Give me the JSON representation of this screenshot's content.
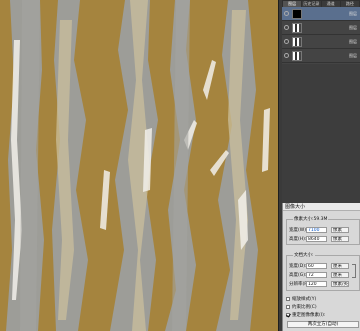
{
  "layers_panel": {
    "tabs": [
      "图层",
      "历史记录",
      "通道",
      "路径"
    ],
    "active_tab": 0,
    "layers": [
      {
        "name": "",
        "selected": true,
        "thumb": "black",
        "right_label": "图层"
      },
      {
        "name": "",
        "selected": false,
        "thumb": "pattern",
        "right_label": "图层"
      },
      {
        "name": "",
        "selected": false,
        "thumb": "pattern",
        "right_label": "图层"
      },
      {
        "name": "",
        "selected": false,
        "thumb": "pattern",
        "right_label": "图层"
      }
    ]
  },
  "image_size_dialog": {
    "title": "图像大小",
    "pixel_dims_label": "像素大小:59.3M",
    "width_label": "宽度(W):",
    "width_value": "7100",
    "height_label": "高度(H):",
    "height_value": "8640",
    "pixel_unit": "像素",
    "doc_size_label": "文档大小:",
    "doc_width_label": "宽度(D):",
    "doc_width_value": "60",
    "doc_height_label": "高度(G):",
    "doc_height_value": "72",
    "doc_unit": "厘米",
    "resolution_label": "分辨率(R):",
    "resolution_value": "120",
    "resolution_unit": "像素/英寸",
    "checkboxes": [
      {
        "label": "缩放样式(Y)",
        "checked": false
      },
      {
        "label": "约束比例(C)",
        "checked": false
      },
      {
        "label": "重定图像像素(I):",
        "checked": true
      }
    ],
    "resample_option": "两次立方(自动)"
  },
  "colors": {
    "canvas_gold": "#a5843e",
    "canvas_gray": "#9a9b97",
    "canvas_light": "#cfcab9",
    "selected_layer": "#5a6f8e"
  }
}
